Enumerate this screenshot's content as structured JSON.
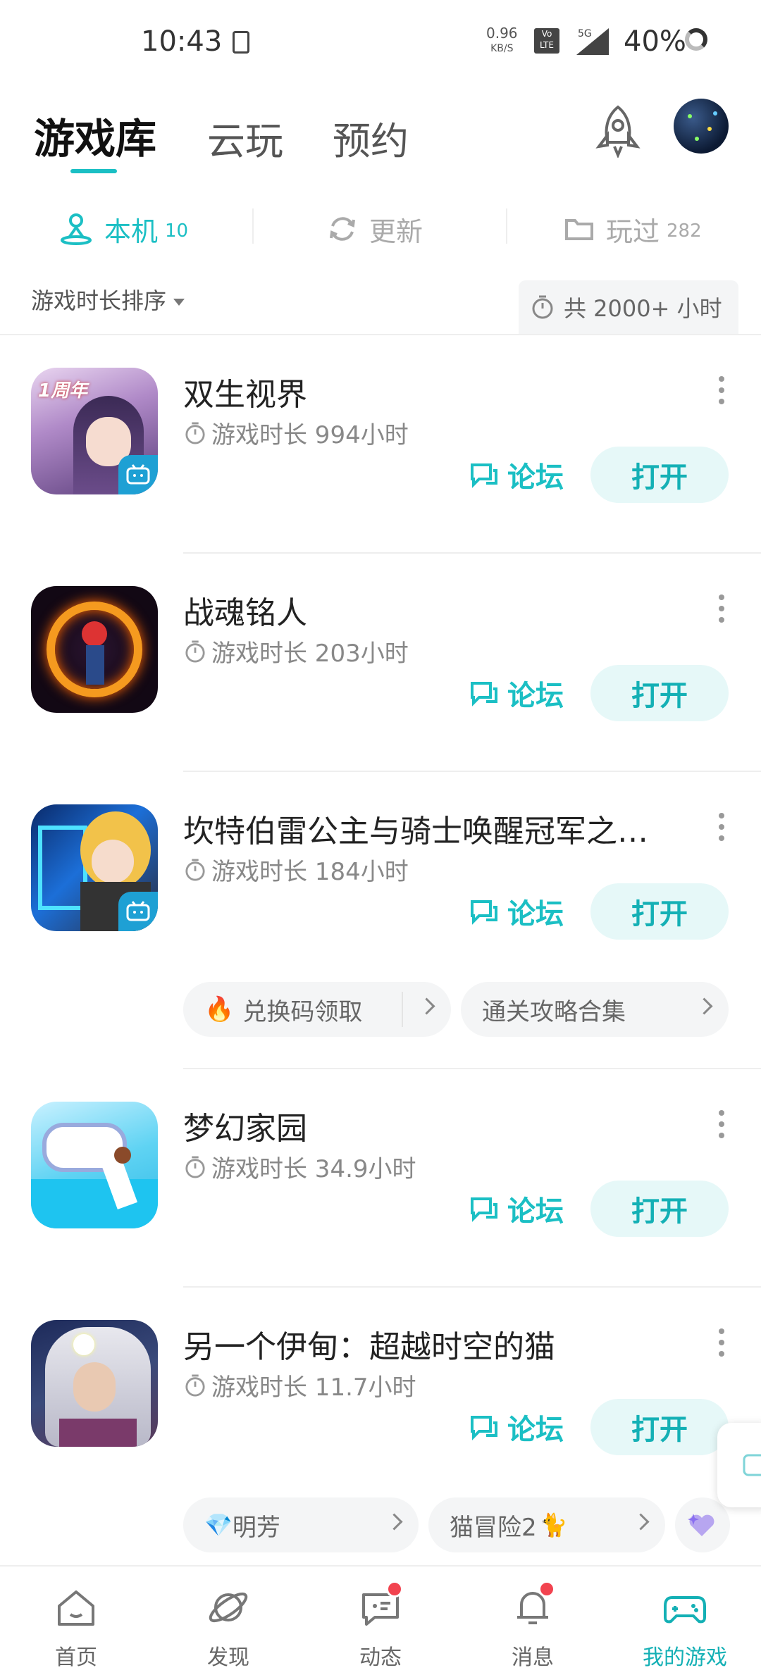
{
  "status_bar": {
    "time": "10:43",
    "net_speed": "0.96",
    "net_unit": "KB/S",
    "volte": "Vo LTE",
    "signal": "5G",
    "battery": "40%"
  },
  "header": {
    "tabs": [
      "游戏库",
      "云玩",
      "预约"
    ],
    "active_tab": "游戏库"
  },
  "subtabs": [
    {
      "label": "本机",
      "count": "10",
      "icon": "person-stand-icon"
    },
    {
      "label": "更新",
      "count": "",
      "icon": "refresh-icon"
    },
    {
      "label": "玩过",
      "count": "282",
      "icon": "folder-icon"
    }
  ],
  "sort": {
    "label": "游戏时长排序",
    "total": "共 2000+ 小时"
  },
  "games": [
    {
      "title": "双生视界",
      "playtime": "游戏时长 994小时",
      "forum": "论坛",
      "open": "打开",
      "badge": "1周年"
    },
    {
      "title": "战魂铭人",
      "playtime": "游戏时长 203小时",
      "forum": "论坛",
      "open": "打开"
    },
    {
      "title": "坎特伯雷公主与骑士唤醒冠军之…",
      "playtime": "游戏时长 184小时",
      "forum": "论坛",
      "open": "打开",
      "chips": [
        {
          "label": "兑换码领取",
          "icon": "fire-icon"
        },
        {
          "label": "通关攻略合集"
        }
      ]
    },
    {
      "title": "梦幻家园",
      "playtime": "游戏时长 34.9小时",
      "forum": "论坛",
      "open": "打开"
    },
    {
      "title": "另一个伊甸：超越时空的猫",
      "playtime": "游戏时长 11.7小时",
      "forum": "论坛",
      "open": "打开",
      "chips": [
        {
          "label": "明芳",
          "icon": "diamond-icon"
        },
        {
          "label": "猫冒险2",
          "icon": "cat-icon"
        }
      ]
    }
  ],
  "bottom_nav": [
    {
      "label": "首页",
      "icon": "home-icon"
    },
    {
      "label": "发现",
      "icon": "planet-icon"
    },
    {
      "label": "动态",
      "icon": "chat-icon",
      "dot": true
    },
    {
      "label": "消息",
      "icon": "bell-icon",
      "dot": true
    },
    {
      "label": "我的游戏",
      "icon": "gamepad-icon",
      "active": true
    }
  ],
  "colors": {
    "accent": "#1bbfc4",
    "open_bg": "#e6f8f8",
    "badge_red": "#f2434f"
  }
}
